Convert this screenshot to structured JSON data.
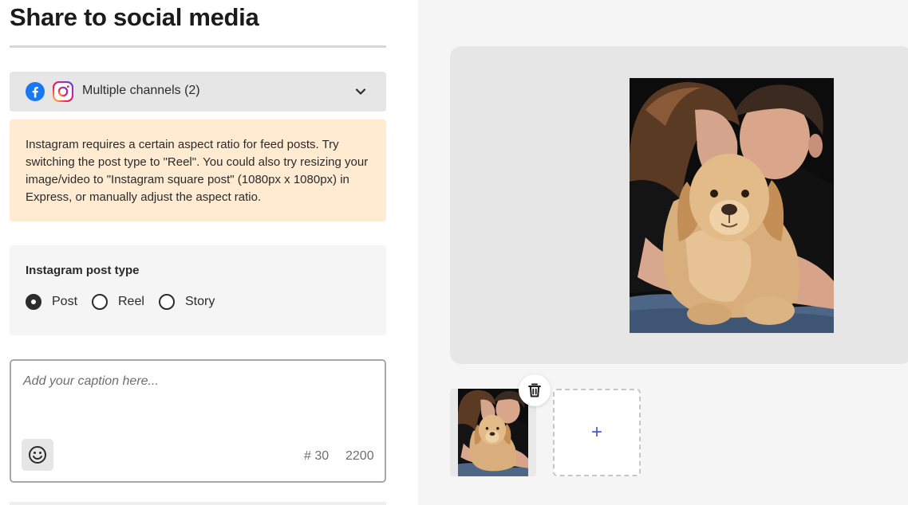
{
  "title": "Share to social media",
  "channels": {
    "label": "Multiple channels (2)",
    "icons": [
      "facebook-icon",
      "instagram-icon"
    ],
    "facebook_color": "#1877F2",
    "instagram_color": "#E1306C"
  },
  "alert": {
    "text": "Instagram requires a certain aspect ratio for feed posts. Try switching the post type to \"Reel\". You could also try resizing your image/video to \"Instagram square post\" (1080px x 1080px) in Express, or manually adjust the aspect ratio.",
    "background": "#FFEBD2"
  },
  "post_type": {
    "label": "Instagram post type",
    "options": [
      "Post",
      "Reel",
      "Story"
    ],
    "selected": "Post"
  },
  "caption": {
    "placeholder": "Add your caption here...",
    "hashtag_count": "# 30",
    "max_chars": "2200"
  },
  "add_tile": {
    "symbol": "+"
  },
  "colors": {
    "accent": "#4B58C7",
    "preview_bg": "#E6E6E6",
    "right_panel_bg": "#F5F5F5"
  }
}
